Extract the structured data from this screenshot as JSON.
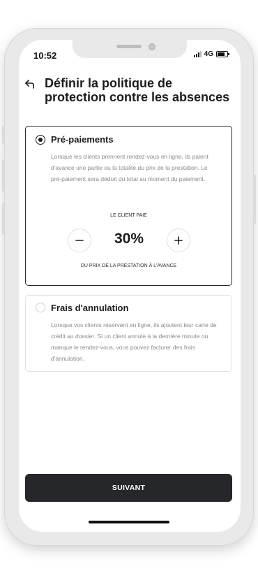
{
  "status_bar": {
    "time": "10:52",
    "network": "4G"
  },
  "header": {
    "title": "Définir la politique de protection contre les absences"
  },
  "options": [
    {
      "title": "Pré-paiements",
      "selected": true,
      "description": "Lorsque les clients prennent rendez-vous en ligne, ils paient d'avance une partie ou la totalité du prix de la prestation. Le pré-paiement sera déduit du total au moment du paiement.",
      "pays_label": "LE CLIENT PAIE",
      "value": "30%",
      "after_label": "DU PRIX DE LA PRESTATION À L'AVANCE"
    },
    {
      "title": "Frais d'annulation",
      "selected": false,
      "description": "Lorsque vos clients réservent en ligne, ils ajoutent leur carte de crédit au dossier. Si un client annule à la dernière minute ou manque le rendez-vous, vous pouvez facturer des frais d'annulation."
    }
  ],
  "footer": {
    "next_label": "SUIVANT"
  },
  "icons": {
    "back": "back-arrow-icon",
    "minus": "minus-icon",
    "plus": "plus-icon",
    "signal": "signal-icon",
    "battery": "battery-icon"
  },
  "colors": {
    "primary_button": "#26272b",
    "text": "#1c1c1c",
    "muted_text": "#8a8a8a"
  }
}
